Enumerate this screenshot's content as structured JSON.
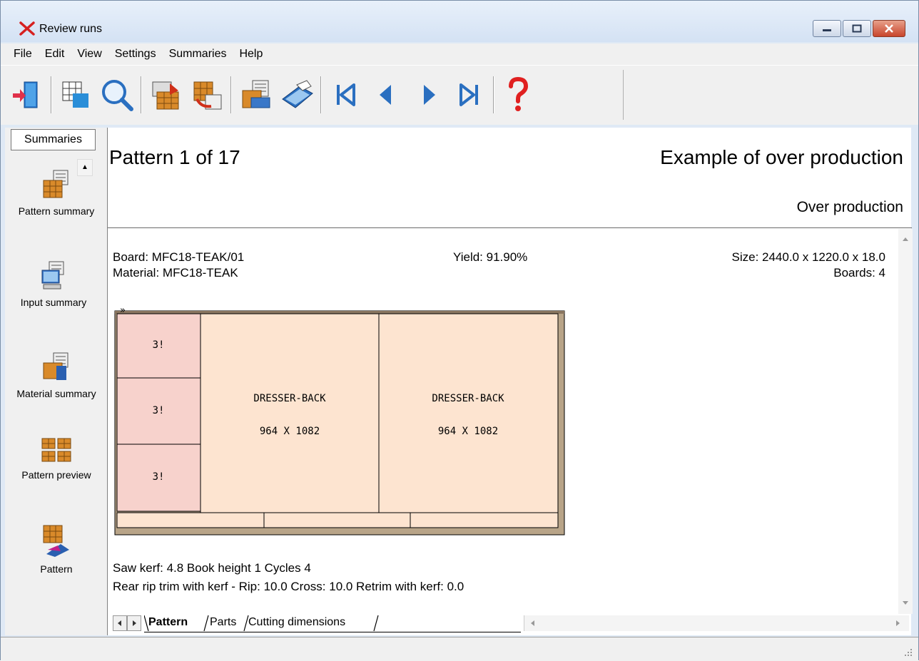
{
  "window": {
    "title": "Review runs",
    "accent": "#d4e2f4"
  },
  "menu": {
    "items": [
      "File",
      "Edit",
      "View",
      "Settings",
      "Summaries",
      "Help"
    ]
  },
  "toolbar": {
    "icons": [
      "exit-icon",
      "grid-icon",
      "search-icon",
      "pattern-arrow-icon",
      "pattern-undo-icon",
      "report-icon",
      "printer-icon",
      "first-icon",
      "prev-icon",
      "next-icon",
      "last-icon",
      "help-icon"
    ]
  },
  "sidebar": {
    "tab_label": "Summaries",
    "items": [
      {
        "label": "Pattern summary",
        "icon": "pattern-summary-icon"
      },
      {
        "label": "Input summary",
        "icon": "input-summary-icon"
      },
      {
        "label": "Material summary",
        "icon": "material-summary-icon"
      },
      {
        "label": "Pattern preview",
        "icon": "pattern-preview-icon"
      },
      {
        "label": "Pattern",
        "icon": "pattern-icon"
      }
    ]
  },
  "header": {
    "pattern_label": "Pattern 1 of 17",
    "example_title": "Example of over production",
    "over_production": "Over production"
  },
  "board": {
    "board": "Board: MFC18-TEAK/01",
    "material": "Material: MFC18-TEAK",
    "yield": "Yield: 91.90%",
    "size": "Size: 2440.0 x 1220.0 x  18.0",
    "boards": "Boards: 4"
  },
  "diagram": {
    "marker": "»",
    "small_parts": [
      "3!",
      "3!",
      "3!"
    ],
    "big_parts": [
      {
        "name": "DRESSER-BACK",
        "dims": "964 X 1082"
      },
      {
        "name": "DRESSER-BACK",
        "dims": "964 X 1082"
      }
    ],
    "colors": {
      "small": "#f7d2cc",
      "big": "#fde4d0",
      "trim": "#b8a488"
    }
  },
  "footer": {
    "line1": "Saw kerf: 4.8  Book height 1  Cycles 4",
    "line2": "Rear rip trim with kerf - Rip: 10.0 Cross: 10.0 Retrim with kerf: 0.0"
  },
  "tabs": [
    "Pattern",
    "Parts",
    "Cutting dimensions"
  ]
}
